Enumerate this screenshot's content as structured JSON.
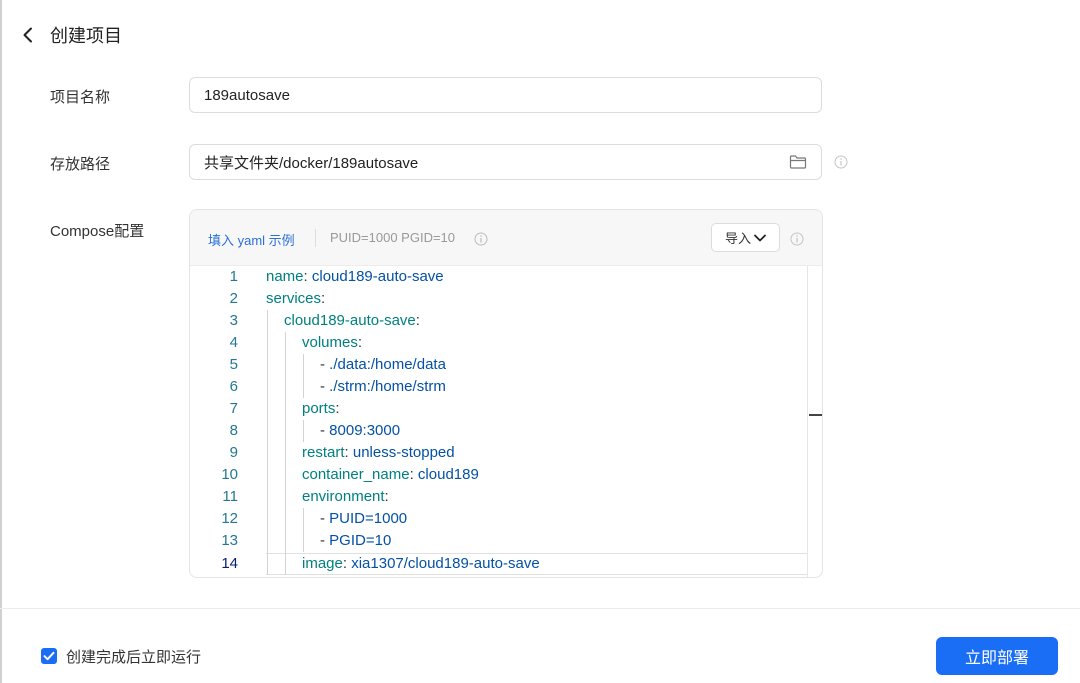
{
  "header": {
    "title": "创建项目"
  },
  "form": {
    "name_label": "项目名称",
    "name_value": "189autosave",
    "path_label": "存放路径",
    "path_value": "共享文件夹/docker/189autosave",
    "compose_label": "Compose配置"
  },
  "editor": {
    "fill_example": "填入 yaml 示例",
    "puid_hint": "PUID=1000 PGID=10",
    "import_label": "导入",
    "current_line": 14,
    "lines": [
      {
        "n": "1",
        "k": "name",
        "sep": ": ",
        "v": "cloud189-auto-save"
      },
      {
        "n": "2",
        "k": "services",
        "sep": ":",
        "v": ""
      },
      {
        "n": "3",
        "k": "cloud189-auto-save",
        "sep": ":",
        "v": ""
      },
      {
        "n": "4",
        "k": "volumes",
        "sep": ":",
        "v": ""
      },
      {
        "n": "5",
        "k": "",
        "sep": "- ",
        "v": "./data:/home/data"
      },
      {
        "n": "6",
        "k": "",
        "sep": "- ",
        "v": "./strm:/home/strm"
      },
      {
        "n": "7",
        "k": "ports",
        "sep": ":",
        "v": ""
      },
      {
        "n": "8",
        "k": "",
        "sep": "- ",
        "v": "8009:3000"
      },
      {
        "n": "9",
        "k": "restart",
        "sep": ": ",
        "v": "unless-stopped"
      },
      {
        "n": "10",
        "k": "container_name",
        "sep": ": ",
        "v": "cloud189"
      },
      {
        "n": "11",
        "k": "environment",
        "sep": ":",
        "v": ""
      },
      {
        "n": "12",
        "k": "",
        "sep": "- ",
        "v": "PUID=1000"
      },
      {
        "n": "13",
        "k": "",
        "sep": "- ",
        "v": "PGID=10"
      },
      {
        "n": "14",
        "k": "image",
        "sep": ": ",
        "v": "xia1307/cloud189-auto-save"
      }
    ]
  },
  "footer": {
    "run_after_create_label": "创建完成后立即运行",
    "run_after_create_checked": true,
    "deploy_label": "立即部署"
  },
  "colors": {
    "accent": "#1a6ef5",
    "yaml_key": "#008080",
    "yaml_value": "#0451a5",
    "line_number": "#237893"
  }
}
